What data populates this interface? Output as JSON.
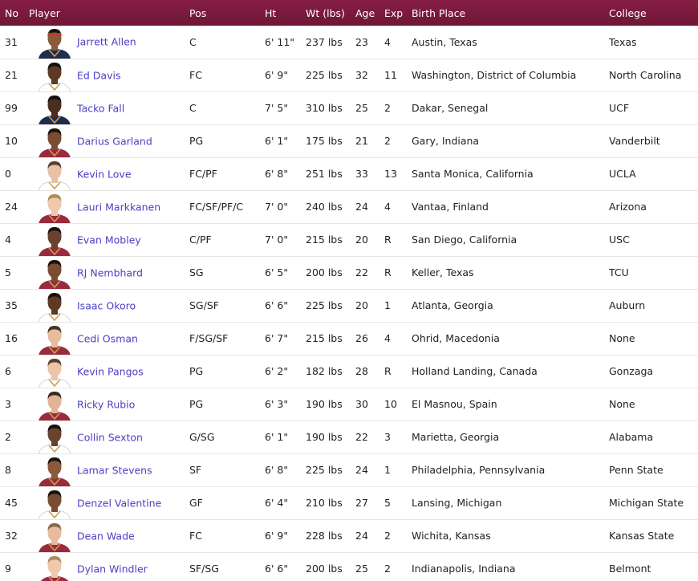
{
  "header": {
    "no": "No",
    "player": "Player",
    "pos": "Pos",
    "ht": "Ht",
    "wt": "Wt (lbs)",
    "age": "Age",
    "exp": "Exp",
    "birth_place": "Birth Place",
    "college": "College"
  },
  "colors": {
    "header_bg": "#7a1a3d",
    "link": "#4b3fc4",
    "jersey_red": "#9a2a3e",
    "jersey_navy": "#1f2c4d"
  },
  "rows": [
    {
      "no": "31",
      "player": "Jarrett Allen",
      "pos": "C",
      "ht": "6' 11\"",
      "wt": "237 lbs",
      "age": "23",
      "exp": "4",
      "birth_place": "Austin, Texas",
      "college": "Texas",
      "skin": "#8a5a3b",
      "hair": "#1a1210",
      "jersey": "#1f2c4d",
      "band": true
    },
    {
      "no": "21",
      "player": "Ed Davis",
      "pos": "FC",
      "ht": "6' 9\"",
      "wt": "225 lbs",
      "age": "32",
      "exp": "11",
      "birth_place": "Washington, District of Columbia",
      "college": "North Carolina",
      "skin": "#5e3a26",
      "hair": "#141010",
      "jersey": "#ffffff",
      "band": false
    },
    {
      "no": "99",
      "player": "Tacko Fall",
      "pos": "C",
      "ht": "7' 5\"",
      "wt": "310 lbs",
      "age": "25",
      "exp": "2",
      "birth_place": "Dakar, Senegal",
      "college": "UCF",
      "skin": "#4a2e20",
      "hair": "#141010",
      "jersey": "#1f2c4d",
      "band": false
    },
    {
      "no": "10",
      "player": "Darius Garland",
      "pos": "PG",
      "ht": "6' 1\"",
      "wt": "175 lbs",
      "age": "21",
      "exp": "2",
      "birth_place": "Gary, Indiana",
      "college": "Vanderbilt",
      "skin": "#7a4c32",
      "hair": "#1a1210",
      "jersey": "#9a2a3e",
      "band": false
    },
    {
      "no": "0",
      "player": "Kevin Love",
      "pos": "FC/PF",
      "ht": "6' 8\"",
      "wt": "251 lbs",
      "age": "33",
      "exp": "13",
      "birth_place": "Santa Monica, California",
      "college": "UCLA",
      "skin": "#e8c0a4",
      "hair": "#5a4030",
      "jersey": "#ffffff",
      "band": false
    },
    {
      "no": "24",
      "player": "Lauri Markkanen",
      "pos": "FC/SF/PF/C",
      "ht": "7' 0\"",
      "wt": "240 lbs",
      "age": "24",
      "exp": "4",
      "birth_place": "Vantaa, Finland",
      "college": "Arizona",
      "skin": "#f0c8ac",
      "hair": "#b08a5a",
      "jersey": "#9a2a3e",
      "band": false
    },
    {
      "no": "4",
      "player": "Evan Mobley",
      "pos": "C/PF",
      "ht": "7' 0\"",
      "wt": "215 lbs",
      "age": "20",
      "exp": "R",
      "birth_place": "San Diego, California",
      "college": "USC",
      "skin": "#6a4230",
      "hair": "#1a1210",
      "jersey": "#9a2a3e",
      "band": false
    },
    {
      "no": "5",
      "player": "RJ Nembhard",
      "pos": "SG",
      "ht": "6' 5\"",
      "wt": "200 lbs",
      "age": "22",
      "exp": "R",
      "birth_place": "Keller, Texas",
      "college": "TCU",
      "skin": "#7a4c32",
      "hair": "#1a1210",
      "jersey": "#9a2a3e",
      "band": false
    },
    {
      "no": "35",
      "player": "Isaac Okoro",
      "pos": "SG/SF",
      "ht": "6' 6\"",
      "wt": "225 lbs",
      "age": "20",
      "exp": "1",
      "birth_place": "Atlanta, Georgia",
      "college": "Auburn",
      "skin": "#5e3a26",
      "hair": "#141010",
      "jersey": "#ffffff",
      "band": false
    },
    {
      "no": "16",
      "player": "Cedi Osman",
      "pos": "F/SG/SF",
      "ht": "6' 7\"",
      "wt": "215 lbs",
      "age": "26",
      "exp": "4",
      "birth_place": "Ohrid, Macedonia",
      "college": "None",
      "skin": "#e6bc9c",
      "hair": "#4a3426",
      "jersey": "#9a2a3e",
      "band": false
    },
    {
      "no": "6",
      "player": "Kevin Pangos",
      "pos": "PG",
      "ht": "6' 2\"",
      "wt": "182 lbs",
      "age": "28",
      "exp": "R",
      "birth_place": "Holland Landing, Canada",
      "college": "Gonzaga",
      "skin": "#ecc4a6",
      "hair": "#5a4030",
      "jersey": "#ffffff",
      "band": false
    },
    {
      "no": "3",
      "player": "Ricky Rubio",
      "pos": "PG",
      "ht": "6' 3\"",
      "wt": "190 lbs",
      "age": "30",
      "exp": "10",
      "birth_place": "El Masnou, Spain",
      "college": "None",
      "skin": "#e0b494",
      "hair": "#3a2a20",
      "jersey": "#9a2a3e",
      "band": false
    },
    {
      "no": "2",
      "player": "Collin Sexton",
      "pos": "G/SG",
      "ht": "6' 1\"",
      "wt": "190 lbs",
      "age": "22",
      "exp": "3",
      "birth_place": "Marietta, Georgia",
      "college": "Alabama",
      "skin": "#6a4230",
      "hair": "#141010",
      "jersey": "#ffffff",
      "band": false
    },
    {
      "no": "8",
      "player": "Lamar Stevens",
      "pos": "SF",
      "ht": "6' 8\"",
      "wt": "225 lbs",
      "age": "24",
      "exp": "1",
      "birth_place": "Philadelphia, Pennsylvania",
      "college": "Penn State",
      "skin": "#8a5a3b",
      "hair": "#1a1210",
      "jersey": "#9a2a3e",
      "band": false
    },
    {
      "no": "45",
      "player": "Denzel Valentine",
      "pos": "GF",
      "ht": "6' 4\"",
      "wt": "210 lbs",
      "age": "27",
      "exp": "5",
      "birth_place": "Lansing, Michigan",
      "college": "Michigan State",
      "skin": "#7a4c32",
      "hair": "#1a1210",
      "jersey": "#ffffff",
      "band": false
    },
    {
      "no": "32",
      "player": "Dean Wade",
      "pos": "FC",
      "ht": "6' 9\"",
      "wt": "228 lbs",
      "age": "24",
      "exp": "2",
      "birth_place": "Wichita, Kansas",
      "college": "Kansas State",
      "skin": "#e6bc9c",
      "hair": "#8a6a4a",
      "jersey": "#9a2a3e",
      "band": false
    },
    {
      "no": "9",
      "player": "Dylan Windler",
      "pos": "SF/SG",
      "ht": "6' 6\"",
      "wt": "200 lbs",
      "age": "25",
      "exp": "2",
      "birth_place": "Indianapolis, Indiana",
      "college": "Belmont",
      "skin": "#f0c8ac",
      "hair": "#b08a5a",
      "jersey": "#9a2a3e",
      "band": false
    }
  ]
}
